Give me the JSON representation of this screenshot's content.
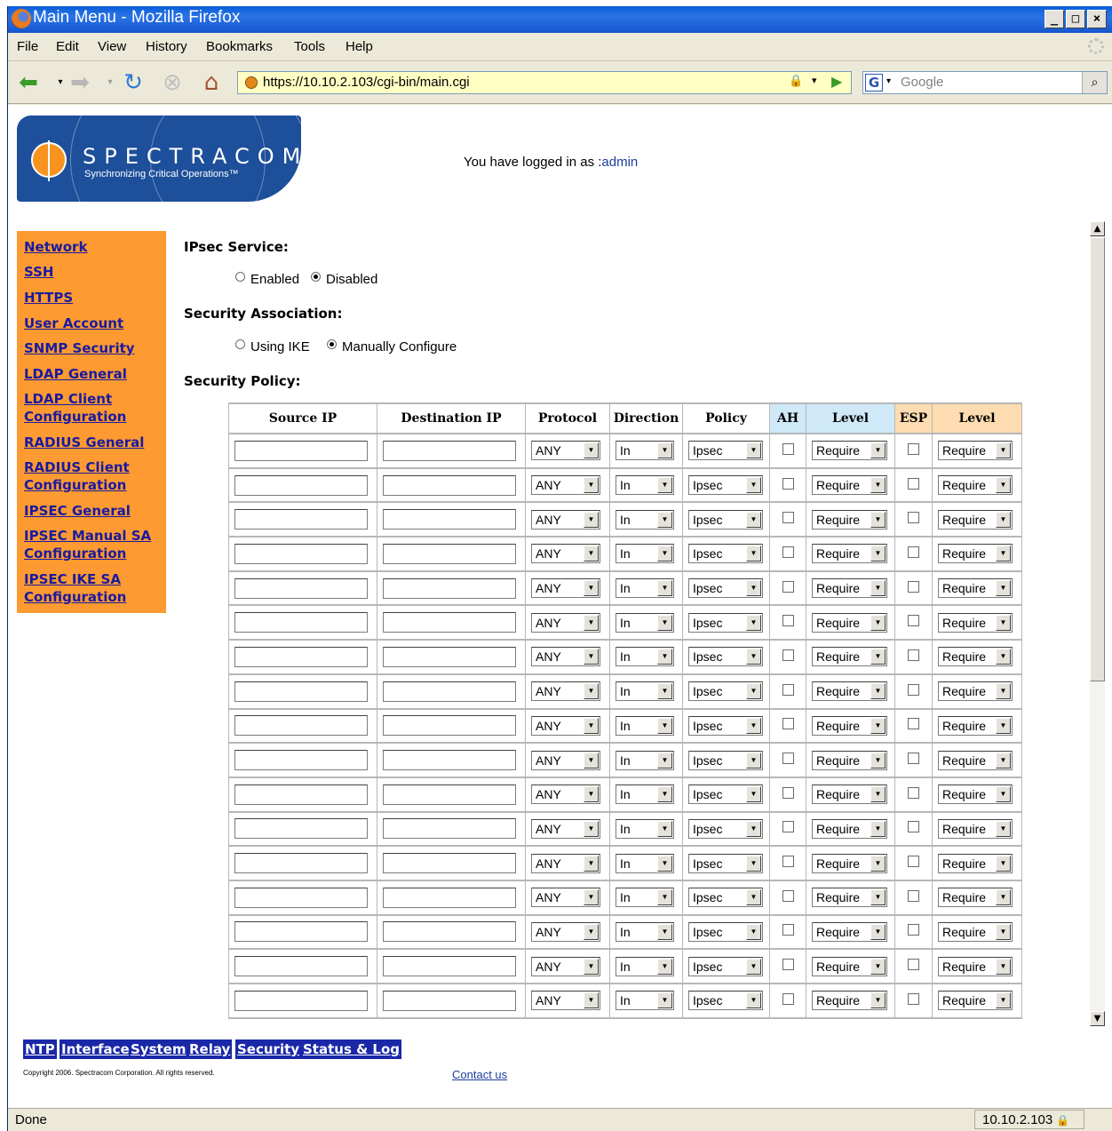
{
  "window": {
    "title": "Main Menu - Mozilla Firefox",
    "min": "_",
    "max": "□",
    "close": "×"
  },
  "menu": [
    "File",
    "Edit",
    "View",
    "History",
    "Bookmarks",
    "Tools",
    "Help"
  ],
  "toolbar": {
    "url": "https://10.10.2.103/cgi-bin/main.cgi",
    "search_placeholder": "Google"
  },
  "header": {
    "brand": "SPECTRACOM",
    "tagline": "Synchronizing Critical Operations™",
    "login_text": "You have logged in as :",
    "login_user": "admin"
  },
  "sidenav": [
    [
      "Network"
    ],
    [
      "SSH"
    ],
    [
      "HTTPS"
    ],
    [
      "User Account"
    ],
    [
      "SNMP Security"
    ],
    [
      "LDAP General"
    ],
    [
      "LDAP Client",
      "Configuration"
    ],
    [
      "RADIUS General"
    ],
    [
      "RADIUS Client",
      "Configuration"
    ],
    [
      "IPSEC General"
    ],
    [
      "IPSEC Manual SA",
      "Configuration"
    ],
    [
      "IPSEC IKE SA",
      "Configuration"
    ]
  ],
  "form": {
    "ipsec_service_label": "IPsec Service:",
    "enabled_label": "Enabled",
    "disabled_label": "Disabled",
    "ipsec_service_value": "Disabled",
    "sa_label": "Security Association:",
    "ike_label": "Using IKE",
    "manual_label": "Manually Configure",
    "sa_value": "Manually Configure",
    "policy_label": "Security Policy:"
  },
  "policy_table": {
    "columns": [
      "Source IP",
      "Destination IP",
      "Protocol",
      "Direction",
      "Policy",
      "AH",
      "Level",
      "ESP",
      "Level"
    ],
    "row_defaults": {
      "source_ip": "",
      "destination_ip": "",
      "protocol": "ANY",
      "direction": "In",
      "policy": "Ipsec",
      "ah": false,
      "ah_level": "Require",
      "esp": false,
      "esp_level": "Require"
    },
    "visible_rows": 17
  },
  "footer": {
    "tabs": [
      "NTP",
      "Interface",
      "System",
      "Relay",
      "Security",
      "Status & Log"
    ],
    "copyright": "Copyright 2006. Spectracom Corporation. All rights reserved.",
    "contact": "Contact us"
  },
  "status": {
    "text": "Done",
    "host": "10.10.2.103"
  },
  "colors": {
    "sidenav_bg": "#fd9a31",
    "link": "#1a1aa0",
    "ah_header": "#cfe9f9",
    "esp_header": "#fcdcb0",
    "logo_bg": "#1d4f9a"
  }
}
